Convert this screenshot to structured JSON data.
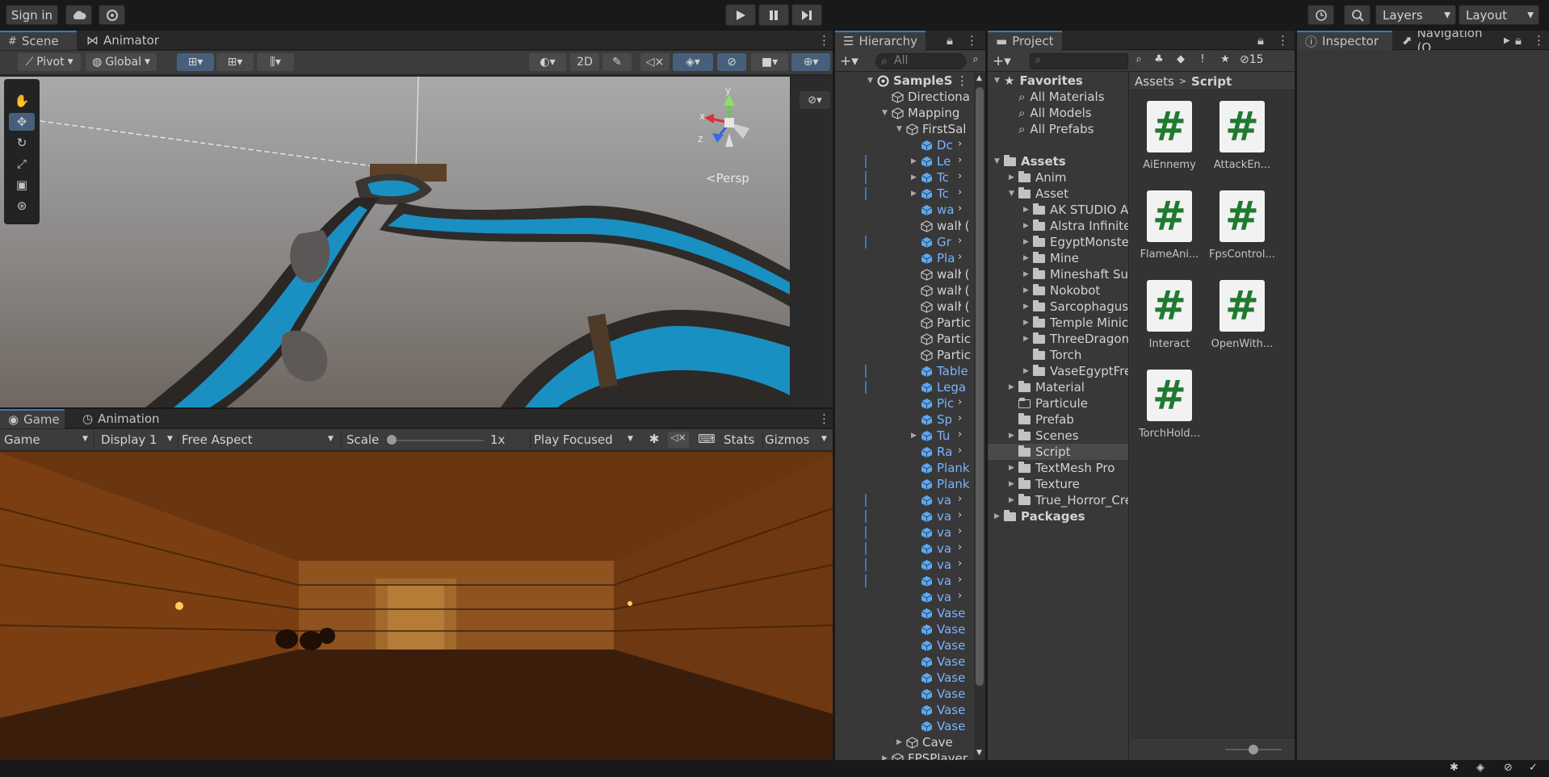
{
  "topbar": {
    "sign_in": "Sign in",
    "layers": "Layers",
    "layout": "Layout"
  },
  "scene": {
    "tabs": [
      "Scene",
      "Animator"
    ],
    "pivot": "Pivot",
    "global": "Global",
    "mode_2d": "2D",
    "persp": "Persp",
    "axes": {
      "x": "x",
      "y": "y",
      "z": "z"
    }
  },
  "game": {
    "tabs": [
      "Game",
      "Animation"
    ],
    "view": "Game",
    "display": "Display 1",
    "aspect": "Free Aspect",
    "scale_label": "Scale",
    "scale_value": "1x",
    "play_focused": "Play Focused",
    "stats": "Stats",
    "gizmos": "Gizmos"
  },
  "hierarchy": {
    "tab": "Hierarchy",
    "search_placeholder": "All",
    "items": [
      {
        "label": "SampleS",
        "indent": 0,
        "expand": "open",
        "type": "scene",
        "blue": false,
        "arrow": false
      },
      {
        "label": "Directiona",
        "indent": 1,
        "expand": "none",
        "type": "go",
        "blue": false,
        "arrow": false
      },
      {
        "label": "Mapping",
        "indent": 1,
        "expand": "open",
        "type": "go",
        "blue": false,
        "arrow": false
      },
      {
        "label": "FirstSal",
        "indent": 2,
        "expand": "open",
        "type": "go",
        "blue": false,
        "arrow": false
      },
      {
        "label": "Dc",
        "indent": 3,
        "expand": "none",
        "type": "prefab",
        "blue": true,
        "arrow": true
      },
      {
        "label": "Le",
        "indent": 3,
        "expand": "closed",
        "type": "prefab",
        "blue": true,
        "arrow": true
      },
      {
        "label": "Tc",
        "indent": 3,
        "expand": "closed",
        "type": "prefab",
        "blue": true,
        "arrow": true
      },
      {
        "label": "Tc",
        "indent": 3,
        "expand": "closed",
        "type": "prefab",
        "blue": true,
        "arrow": true
      },
      {
        "label": "wa",
        "indent": 3,
        "expand": "none",
        "type": "prefab",
        "blue": true,
        "arrow": true
      },
      {
        "label": "wall (",
        "indent": 3,
        "expand": "none",
        "type": "go",
        "blue": false,
        "arrow": true
      },
      {
        "label": "Gr",
        "indent": 3,
        "expand": "none",
        "type": "prefab",
        "blue": true,
        "arrow": true
      },
      {
        "label": "Pla",
        "indent": 3,
        "expand": "none",
        "type": "prefab",
        "blue": true,
        "arrow": true
      },
      {
        "label": "wall (",
        "indent": 3,
        "expand": "none",
        "type": "go",
        "blue": false,
        "arrow": true
      },
      {
        "label": "wall (",
        "indent": 3,
        "expand": "none",
        "type": "go",
        "blue": false,
        "arrow": true
      },
      {
        "label": "wall (",
        "indent": 3,
        "expand": "none",
        "type": "go",
        "blue": false,
        "arrow": true
      },
      {
        "label": "Partic",
        "indent": 3,
        "expand": "none",
        "type": "go",
        "blue": false,
        "arrow": false
      },
      {
        "label": "Partic",
        "indent": 3,
        "expand": "none",
        "type": "go",
        "blue": false,
        "arrow": false
      },
      {
        "label": "Partic",
        "indent": 3,
        "expand": "none",
        "type": "go",
        "blue": false,
        "arrow": false
      },
      {
        "label": "Table",
        "indent": 3,
        "expand": "none",
        "type": "prefab",
        "blue": true,
        "arrow": false
      },
      {
        "label": "Lega",
        "indent": 3,
        "expand": "none",
        "type": "prefab",
        "blue": true,
        "arrow": false
      },
      {
        "label": "Pic",
        "indent": 3,
        "expand": "none",
        "type": "prefab",
        "blue": true,
        "arrow": true
      },
      {
        "label": "Sp",
        "indent": 3,
        "expand": "none",
        "type": "prefab",
        "blue": true,
        "arrow": true
      },
      {
        "label": "Tu",
        "indent": 3,
        "expand": "closed",
        "type": "prefab",
        "blue": true,
        "arrow": true
      },
      {
        "label": "Ra",
        "indent": 3,
        "expand": "none",
        "type": "prefab",
        "blue": true,
        "arrow": true
      },
      {
        "label": "Plank",
        "indent": 3,
        "expand": "none",
        "type": "prefab",
        "blue": true,
        "arrow": false
      },
      {
        "label": "Plank",
        "indent": 3,
        "expand": "none",
        "type": "prefab",
        "blue": true,
        "arrow": false
      },
      {
        "label": "va",
        "indent": 3,
        "expand": "none",
        "type": "prefab",
        "blue": true,
        "arrow": true
      },
      {
        "label": "va",
        "indent": 3,
        "expand": "none",
        "type": "prefab",
        "blue": true,
        "arrow": true
      },
      {
        "label": "va",
        "indent": 3,
        "expand": "none",
        "type": "prefab",
        "blue": true,
        "arrow": true
      },
      {
        "label": "va",
        "indent": 3,
        "expand": "none",
        "type": "prefab",
        "blue": true,
        "arrow": true
      },
      {
        "label": "va",
        "indent": 3,
        "expand": "none",
        "type": "prefab",
        "blue": true,
        "arrow": true
      },
      {
        "label": "va",
        "indent": 3,
        "expand": "none",
        "type": "prefab",
        "blue": true,
        "arrow": true
      },
      {
        "label": "va",
        "indent": 3,
        "expand": "none",
        "type": "prefab",
        "blue": true,
        "arrow": true
      },
      {
        "label": "Vase",
        "indent": 3,
        "expand": "none",
        "type": "prefab",
        "blue": true,
        "arrow": false
      },
      {
        "label": "Vase",
        "indent": 3,
        "expand": "none",
        "type": "prefab",
        "blue": true,
        "arrow": false
      },
      {
        "label": "Vase",
        "indent": 3,
        "expand": "none",
        "type": "prefab",
        "blue": true,
        "arrow": false
      },
      {
        "label": "Vase",
        "indent": 3,
        "expand": "none",
        "type": "prefab",
        "blue": true,
        "arrow": false
      },
      {
        "label": "Vase",
        "indent": 3,
        "expand": "none",
        "type": "prefab",
        "blue": true,
        "arrow": false
      },
      {
        "label": "Vase",
        "indent": 3,
        "expand": "none",
        "type": "prefab",
        "blue": true,
        "arrow": false
      },
      {
        "label": "Vase",
        "indent": 3,
        "expand": "none",
        "type": "prefab",
        "blue": true,
        "arrow": false
      },
      {
        "label": "Vase",
        "indent": 3,
        "expand": "none",
        "type": "prefab",
        "blue": true,
        "arrow": false
      },
      {
        "label": "Cave",
        "indent": 2,
        "expand": "closed",
        "type": "go",
        "blue": false,
        "arrow": false
      },
      {
        "label": "FPSPlayer",
        "indent": 1,
        "expand": "closed",
        "type": "go",
        "blue": false,
        "arrow": false
      }
    ]
  },
  "project": {
    "tab": "Project",
    "count": "15",
    "breadcrumb": [
      "Assets",
      "Script"
    ],
    "tree": [
      {
        "label": "Favorites",
        "indent": 0,
        "expand": "open",
        "icon": "star",
        "bold": true
      },
      {
        "label": "All Materials",
        "indent": 1,
        "expand": "none",
        "icon": "search",
        "bold": false
      },
      {
        "label": "All Models",
        "indent": 1,
        "expand": "none",
        "icon": "search",
        "bold": false
      },
      {
        "label": "All Prefabs",
        "indent": 1,
        "expand": "none",
        "icon": "search",
        "bold": false
      },
      {
        "label": "",
        "indent": 0,
        "expand": "none",
        "icon": "none",
        "bold": false
      },
      {
        "label": "Assets",
        "indent": 0,
        "expand": "open",
        "icon": "folder-open",
        "bold": true
      },
      {
        "label": "Anim",
        "indent": 1,
        "expand": "closed",
        "icon": "folder",
        "bold": false
      },
      {
        "label": "Asset",
        "indent": 1,
        "expand": "open",
        "icon": "folder-open",
        "bold": false
      },
      {
        "label": "AK STUDIO A",
        "indent": 2,
        "expand": "closed",
        "icon": "folder",
        "bold": false
      },
      {
        "label": "Alstra Infinite",
        "indent": 2,
        "expand": "closed",
        "icon": "folder",
        "bold": false
      },
      {
        "label": "EgyptMonste",
        "indent": 2,
        "expand": "closed",
        "icon": "folder",
        "bold": false
      },
      {
        "label": "Mine",
        "indent": 2,
        "expand": "closed",
        "icon": "folder",
        "bold": false
      },
      {
        "label": "Mineshaft Su",
        "indent": 2,
        "expand": "closed",
        "icon": "folder",
        "bold": false
      },
      {
        "label": "Nokobot",
        "indent": 2,
        "expand": "closed",
        "icon": "folder",
        "bold": false
      },
      {
        "label": "Sarcophagus",
        "indent": 2,
        "expand": "closed",
        "icon": "folder",
        "bold": false
      },
      {
        "label": "Temple Minic",
        "indent": 2,
        "expand": "closed",
        "icon": "folder",
        "bold": false
      },
      {
        "label": "ThreeDragon",
        "indent": 2,
        "expand": "closed",
        "icon": "folder",
        "bold": false
      },
      {
        "label": "Torch",
        "indent": 2,
        "expand": "none",
        "icon": "folder",
        "bold": false
      },
      {
        "label": "VaseEgyptFre",
        "indent": 2,
        "expand": "closed",
        "icon": "folder",
        "bold": false
      },
      {
        "label": "Material",
        "indent": 1,
        "expand": "closed",
        "icon": "folder",
        "bold": false
      },
      {
        "label": "Particule",
        "indent": 1,
        "expand": "none",
        "icon": "folder-outline",
        "bold": false
      },
      {
        "label": "Prefab",
        "indent": 1,
        "expand": "none",
        "icon": "folder",
        "bold": false
      },
      {
        "label": "Scenes",
        "indent": 1,
        "expand": "closed",
        "icon": "folder",
        "bold": false
      },
      {
        "label": "Script",
        "indent": 1,
        "expand": "none",
        "icon": "folder",
        "bold": false,
        "selected": true
      },
      {
        "label": "TextMesh Pro",
        "indent": 1,
        "expand": "closed",
        "icon": "folder",
        "bold": false
      },
      {
        "label": "Texture",
        "indent": 1,
        "expand": "closed",
        "icon": "folder",
        "bold": false
      },
      {
        "label": "True_Horror_Cre",
        "indent": 1,
        "expand": "closed",
        "icon": "folder",
        "bold": false
      },
      {
        "label": "Packages",
        "indent": 0,
        "expand": "closed",
        "icon": "folder",
        "bold": true
      }
    ],
    "assets": [
      "AiEnnemy",
      "AttackEn...",
      "FlameAni...",
      "FpsControl...",
      "Interact",
      "OpenWith...",
      "TorchHold..."
    ],
    "script_glyph": "#"
  },
  "inspector": {
    "tabs": [
      "Inspector",
      "Navigation (O"
    ]
  },
  "colors": {
    "accent": "#3a79bb",
    "prefab_blue": "#7bb1ff",
    "script_green": "#1f7a2f",
    "water_blue": "#1a8fc2"
  }
}
